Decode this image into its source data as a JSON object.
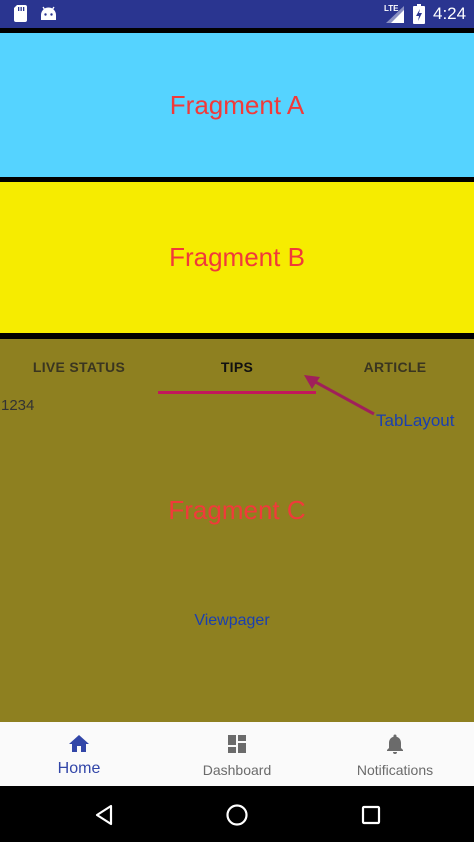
{
  "status_bar": {
    "network_type": "LTE",
    "time": "4:24",
    "icons": [
      "sd-card-icon",
      "android-icon",
      "signal-icon",
      "battery-charging-icon"
    ]
  },
  "fragment_a": {
    "title": "Fragment A",
    "background": "#55d3ff"
  },
  "fragment_b": {
    "title": "Fragment B",
    "background": "#f6ec00"
  },
  "fragment_c": {
    "title": "Fragment C",
    "background": "#8e8020",
    "tabs": [
      {
        "label": "LIVE STATUS",
        "selected": false
      },
      {
        "label": "TIPS",
        "selected": true
      },
      {
        "label": "ARTICLE",
        "selected": false
      }
    ],
    "indicator_color": "#c2185b",
    "content_text": "1234",
    "annotation_tablayout": "TabLayout",
    "annotation_viewpager": "Viewpager"
  },
  "bottom_nav": {
    "items": [
      {
        "label": "Home",
        "icon": "home-icon",
        "active": true
      },
      {
        "label": "Dashboard",
        "icon": "dashboard-icon",
        "active": false
      },
      {
        "label": "Notifications",
        "icon": "bell-icon",
        "active": false
      }
    ],
    "active_color": "#3246a8"
  },
  "system_nav": {
    "buttons": [
      "back-icon",
      "home-circle-icon",
      "recents-icon"
    ]
  }
}
